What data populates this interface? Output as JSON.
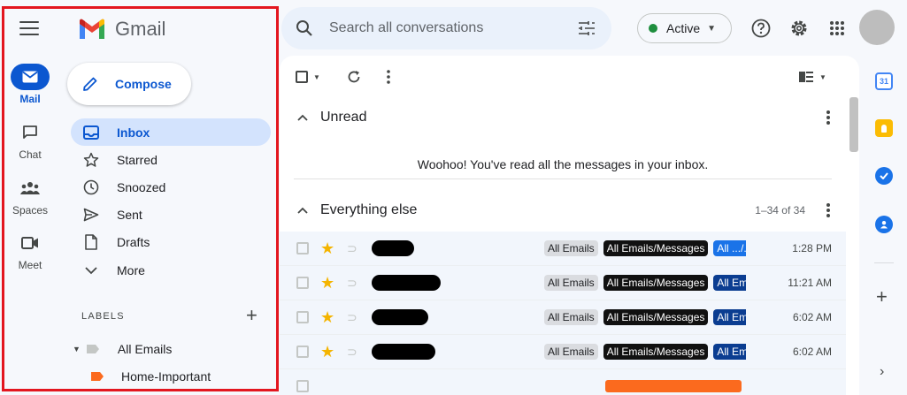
{
  "app": {
    "name": "Gmail"
  },
  "rail": [
    {
      "id": "mail",
      "label": "Mail",
      "active": true
    },
    {
      "id": "chat",
      "label": "Chat",
      "active": false
    },
    {
      "id": "spaces",
      "label": "Spaces",
      "active": false
    },
    {
      "id": "meet",
      "label": "Meet",
      "active": false
    }
  ],
  "compose": {
    "label": "Compose"
  },
  "nav": [
    {
      "label": "Inbox",
      "icon": "inbox-icon",
      "active": true
    },
    {
      "label": "Starred",
      "icon": "star-icon"
    },
    {
      "label": "Snoozed",
      "icon": "clock-icon"
    },
    {
      "label": "Sent",
      "icon": "send-icon"
    },
    {
      "label": "Drafts",
      "icon": "draft-icon"
    },
    {
      "label": "More",
      "icon": "chevron-down-icon"
    }
  ],
  "labels": {
    "header": "LABELS",
    "items": [
      {
        "label": "All Emails",
        "color": "#c4c7c5"
      },
      {
        "label": "Home-Important",
        "color": "#fb6a1e"
      }
    ]
  },
  "search": {
    "placeholder": "Search all conversations"
  },
  "status": {
    "label": "Active",
    "color": "#1e8e3e"
  },
  "sections": {
    "unread": {
      "title": "Unread",
      "empty_message": "Woohoo! You've read all the messages in your inbox."
    },
    "everything_else": {
      "title": "Everything else",
      "count": "1–34 of 34"
    }
  },
  "mails": [
    {
      "chips": [
        "All Emails",
        "All Emails/Messages",
        "All .../..."
      ],
      "blue": "#1a73e8",
      "time": "1:28 PM"
    },
    {
      "chips": [
        "All Emails",
        "All Emails/Messages",
        "All Em"
      ],
      "blue": "#0b3d91",
      "time": "11:21 AM"
    },
    {
      "chips": [
        "All Emails",
        "All Emails/Messages",
        "All Em"
      ],
      "blue": "#0b3d91",
      "time": "6:02 AM"
    },
    {
      "chips": [
        "All Emails",
        "All Emails/Messages",
        "All Em"
      ],
      "blue": "#0b3d91",
      "time": "6:02 AM"
    }
  ],
  "apps": [
    {
      "name": "calendar-icon",
      "text": "31"
    },
    {
      "name": "keep-icon"
    },
    {
      "name": "tasks-icon"
    },
    {
      "name": "contacts-icon"
    }
  ]
}
